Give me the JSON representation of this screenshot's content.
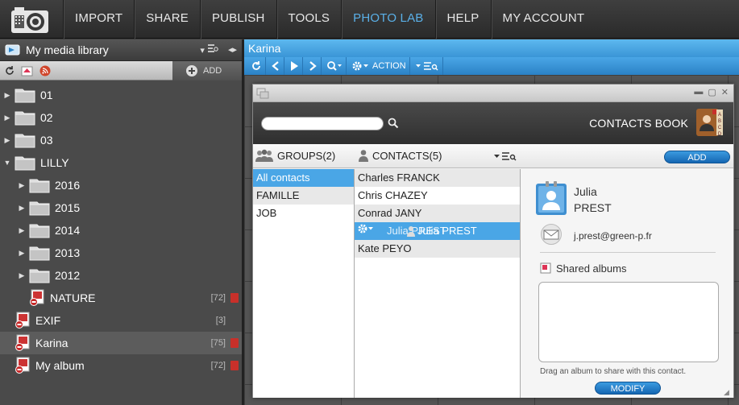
{
  "nav": {
    "items": [
      {
        "label": "IMPORT"
      },
      {
        "label": "SHARE"
      },
      {
        "label": "PUBLISH"
      },
      {
        "label": "TOOLS"
      },
      {
        "label": "PHOTO LAB",
        "active": true
      },
      {
        "label": "HELP"
      },
      {
        "label": "MY ACCOUNT"
      }
    ]
  },
  "library": {
    "title": "My media library",
    "add_label": "ADD",
    "tree": [
      {
        "label": "01",
        "level": 0,
        "type": "folder",
        "expand": "collapsed"
      },
      {
        "label": "02",
        "level": 0,
        "type": "folder",
        "expand": "collapsed"
      },
      {
        "label": "03",
        "level": 0,
        "type": "folder",
        "expand": "collapsed"
      },
      {
        "label": "LILLY",
        "level": 0,
        "type": "folder",
        "expand": "expanded"
      },
      {
        "label": "2016",
        "level": 1,
        "type": "folder",
        "expand": "collapsed"
      },
      {
        "label": "2015",
        "level": 1,
        "type": "folder",
        "expand": "collapsed"
      },
      {
        "label": "2014",
        "level": 1,
        "type": "folder",
        "expand": "collapsed"
      },
      {
        "label": "2013",
        "level": 1,
        "type": "folder",
        "expand": "collapsed"
      },
      {
        "label": "2012",
        "level": 1,
        "type": "folder",
        "expand": "collapsed"
      },
      {
        "label": "NATURE",
        "level": 1,
        "type": "album",
        "count": "[72]",
        "tag": true
      },
      {
        "label": "EXIF",
        "level": 0,
        "type": "album",
        "count": "[3]",
        "tag": false
      },
      {
        "label": "Karina",
        "level": 0,
        "type": "album",
        "count": "[75]",
        "tag": true,
        "selected": true
      },
      {
        "label": "My album",
        "level": 0,
        "type": "album",
        "count": "[72]",
        "tag": true
      }
    ]
  },
  "album_view": {
    "title": "Karina",
    "action_label": "ACTION"
  },
  "contacts_book": {
    "title": "CONTACTS BOOK",
    "search_placeholder": "",
    "groups_tab": "GROUPS(2)",
    "contacts_tab": "CONTACTS(5)",
    "add_label": "ADD",
    "groups": [
      {
        "label": "All contacts",
        "selected": true
      },
      {
        "label": "FAMILLE"
      },
      {
        "label": "JOB"
      }
    ],
    "contacts": [
      {
        "label": "Charles FRANCK"
      },
      {
        "label": "Chris CHAZEY"
      },
      {
        "label": "Conrad JANY"
      },
      {
        "label": "Julia PREST",
        "selected": true
      },
      {
        "label": "Kate PEYO"
      }
    ],
    "drag_label": "Julia PREST",
    "detail": {
      "first_name": "Julia",
      "last_name": "PREST",
      "email": "j.prest@green-p.fr",
      "shared_label": "Shared albums",
      "hint": "Drag an album to share with this contact.",
      "modify_label": "MODIFY"
    }
  },
  "colors": {
    "accent_blue": "#4aa6e6",
    "nav_active": "#5ab0e8",
    "tag_red": "#c8302a"
  }
}
